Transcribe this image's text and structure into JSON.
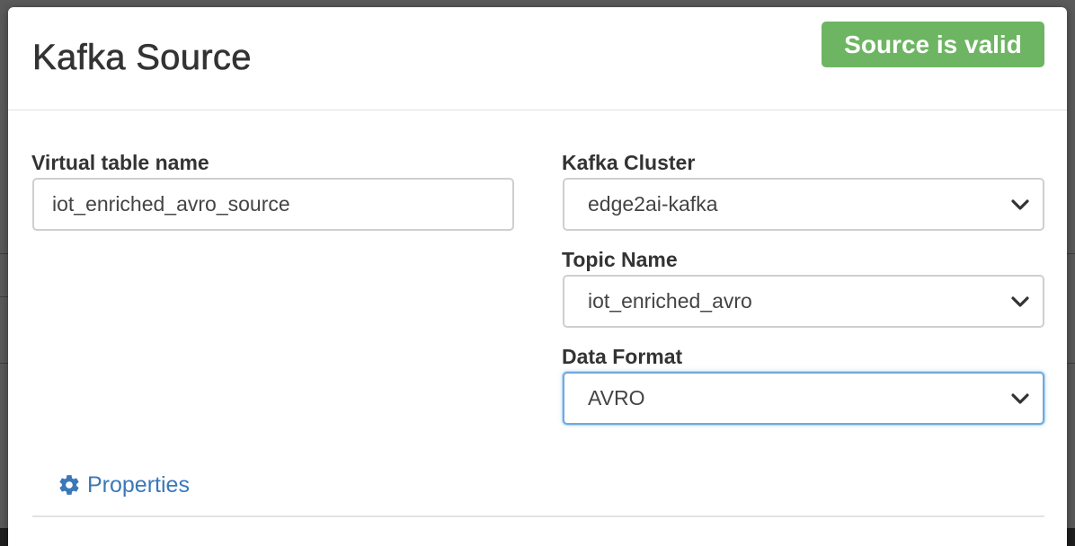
{
  "modal": {
    "title": "Kafka Source",
    "status_badge": "Source is valid"
  },
  "form": {
    "table_name": {
      "label": "Virtual table name",
      "value": "iot_enriched_avro_source"
    },
    "kafka_cluster": {
      "label": "Kafka Cluster",
      "selected": "edge2ai-kafka"
    },
    "topic_name": {
      "label": "Topic Name",
      "selected": "iot_enriched_avro"
    },
    "data_format": {
      "label": "Data Format",
      "selected": "AVRO"
    }
  },
  "properties": {
    "label": "Properties",
    "icon": "gear-icon"
  },
  "colors": {
    "badge_green": "#6db562",
    "link_blue": "#3a78b8",
    "focus_blue": "#74a8db"
  }
}
